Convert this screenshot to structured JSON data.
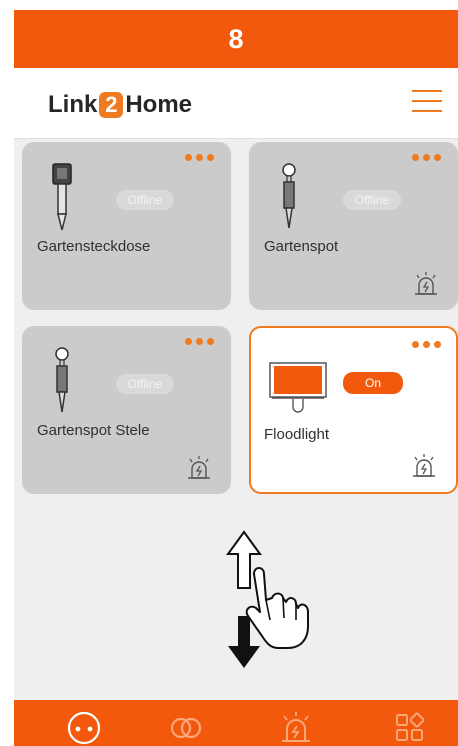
{
  "step": {
    "number": "8"
  },
  "header": {
    "logo_left": "Link",
    "logo_mid": "2",
    "logo_right": "Home",
    "menu_icon": "hamburger-menu-icon"
  },
  "colors": {
    "accent": "#f2590d",
    "accent_light": "#f07a1f",
    "card_offline": "#cbcbcb"
  },
  "devices": [
    {
      "name": "Gartensteckdose",
      "status": "Offline",
      "icon": "garden-socket-icon",
      "alarm": false
    },
    {
      "name": "Gartenspot",
      "status": "Offline",
      "icon": "garden-spot-icon",
      "alarm": true
    },
    {
      "name": "Gartenspot Stele",
      "status": "Offline",
      "icon": "garden-spot-pole-icon",
      "alarm": true
    },
    {
      "name": "Floodlight",
      "status": "On",
      "icon": "floodlight-icon",
      "alarm": true
    }
  ],
  "gesture": {
    "icon": "swipe-up-down-gesture-icon"
  },
  "bottom_nav": [
    {
      "name": "devices-tab",
      "icon": "devices-icon",
      "active": true
    },
    {
      "name": "groups-tab",
      "icon": "link-rings-icon",
      "active": false
    },
    {
      "name": "alarms-tab",
      "icon": "alarm-icon",
      "active": false
    },
    {
      "name": "apps-tab",
      "icon": "apps-grid-icon",
      "active": false
    }
  ]
}
